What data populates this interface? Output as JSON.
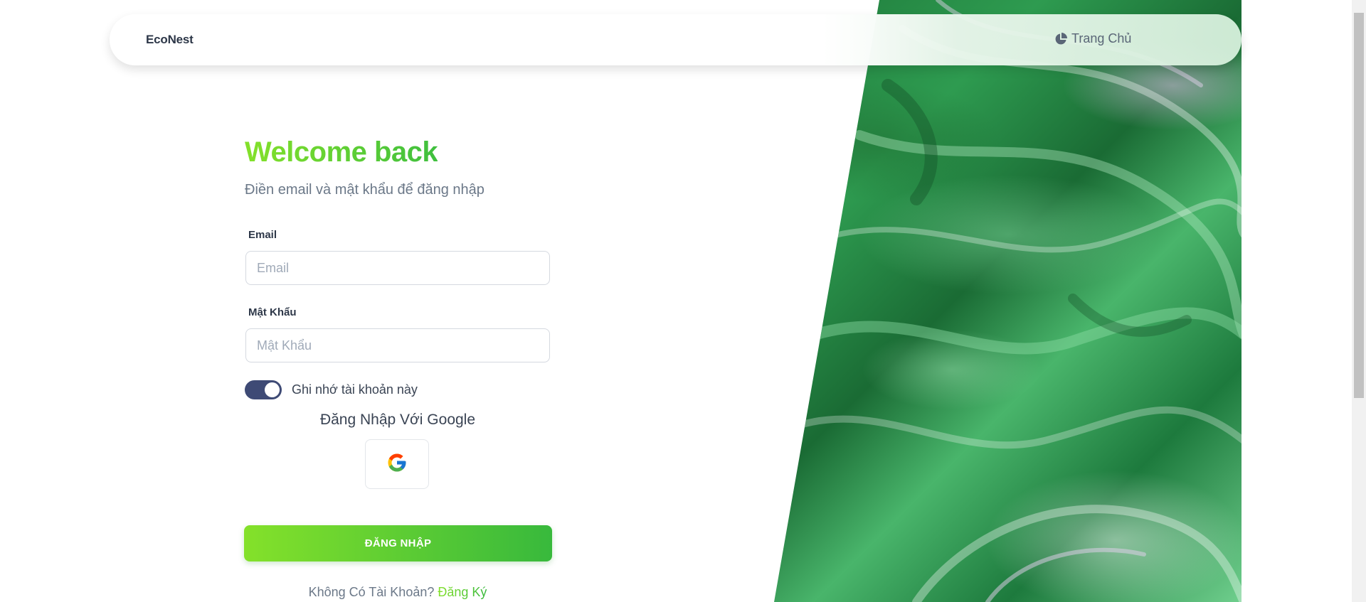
{
  "navbar": {
    "brand": "EcoNest",
    "home_label": "Trang Chủ",
    "home_icon": "pie-chart-icon"
  },
  "form": {
    "title": "Welcome back",
    "subtitle": "Điền email và mật khẩu để đăng nhập",
    "email_label": "Email",
    "email_placeholder": "Email",
    "email_value": "",
    "password_label": "Mật Khẩu",
    "password_placeholder": "Mật Khẩu",
    "password_value": "",
    "remember_label": "Ghi nhớ tài khoản này",
    "remember_checked": true,
    "google_heading": "Đăng Nhập Với Google",
    "google_icon": "google-logo-icon",
    "submit_label": "ĐĂNG NHẬP",
    "no_account_text": "Không Có Tài Khoản?",
    "signup_link": "Đăng Ký"
  },
  "colors": {
    "accent_start": "#84e12a",
    "accent_end": "#38b93c",
    "toggle": "#3e4a75",
    "text_dark": "#2d3748",
    "text_muted": "#6b7888"
  }
}
